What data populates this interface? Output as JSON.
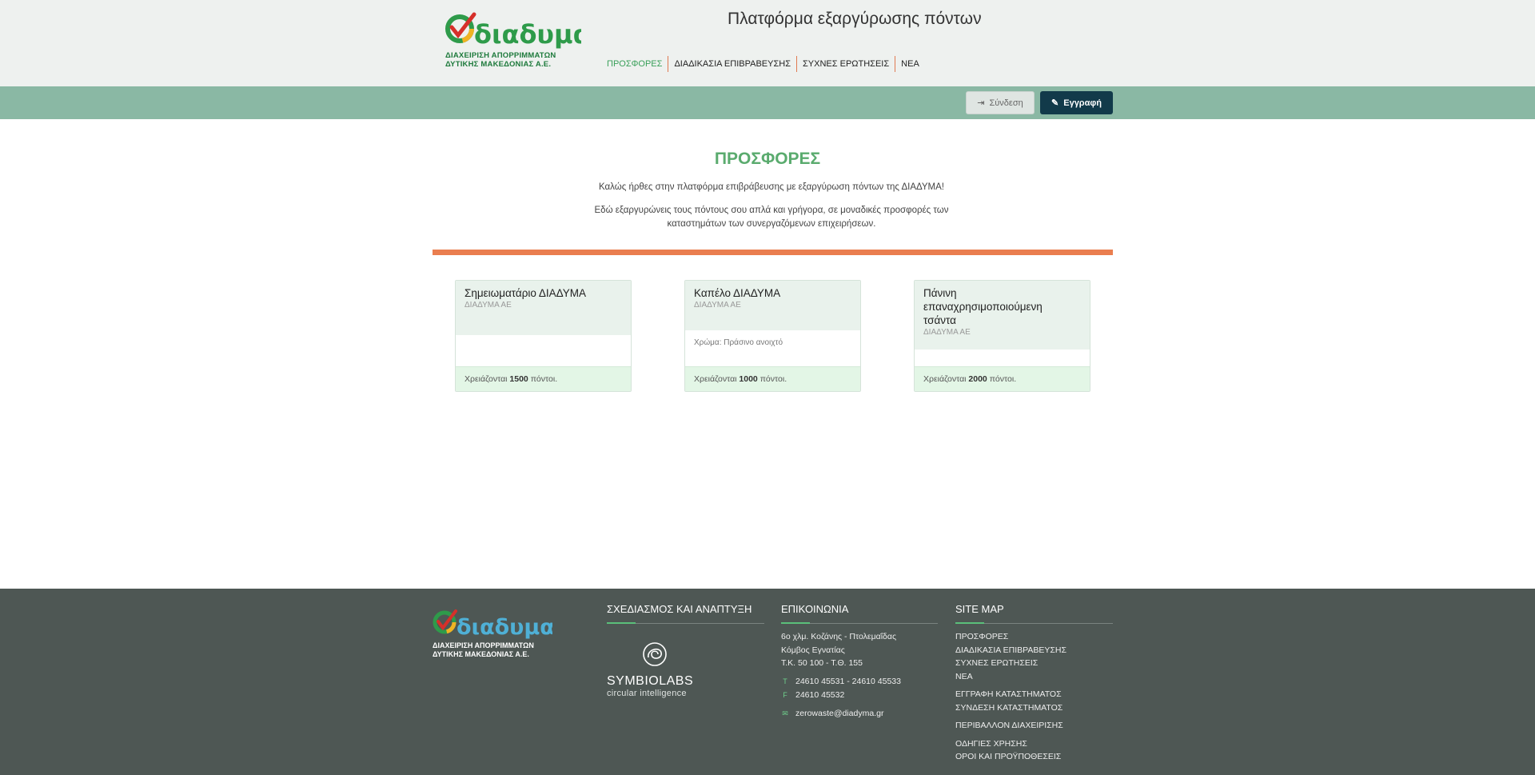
{
  "header": {
    "logo_text": "διαδυμα",
    "logo_subtitle": "ΔΙΑΧΕΙΡΙΣΗ ΑΠΟΡΡΙΜΜΑΤΩΝ\nΔΥΤΙΚΗΣ ΜΑΚΕΔΟΝΙΑΣ Α.Ε.",
    "site_title": "Πλατφόρμα εξαργύρωσης πόντων",
    "nav": [
      {
        "label": "ΠΡΟΣΦΟΡΕΣ",
        "active": true
      },
      {
        "label": "ΔΙΑΔΙΚΑΣΙΑ ΕΠΙΒΡΑΒΕΥΣΗΣ",
        "active": false
      },
      {
        "label": "ΣΥΧΝΕΣ ΕΡΩΤΗΣΕΙΣ",
        "active": false
      },
      {
        "label": "ΝΕΑ",
        "active": false
      }
    ]
  },
  "actions": {
    "login_label": "Σύνδεση",
    "register_label": "Εγγραφή"
  },
  "main": {
    "title": "ΠΡΟΣΦΟΡΕΣ",
    "intro_1": "Καλώς ήρθες στην πλατφόρμα επιβράβευσης με εξαργύρωση πόντων της ΔΙΑΔΥΜΑ!",
    "intro_2": "Εδώ εξαργυρώνεις τους πόντους σου απλά και γρήγορα, σε μοναδικές προσφορές των καταστημάτων των συνεργαζόμενων επιχειρήσεων."
  },
  "offers": [
    {
      "title": "Σημειωματάριο ΔΙΑΔΥΜΑ",
      "company": "ΔΙΑΔΥΜΑ ΑΕ",
      "detail": "",
      "points_prefix": "Χρειάζονται",
      "points": "1500",
      "points_suffix": "πόντοι."
    },
    {
      "title": "Καπέλο ΔΙΑΔΥΜΑ",
      "company": "ΔΙΑΔΥΜΑ ΑΕ",
      "detail": "Χρώμα: Πράσινο ανοιχτό",
      "points_prefix": "Χρειάζονται",
      "points": "1000",
      "points_suffix": "πόντοι."
    },
    {
      "title": "Πάνινη επαναχρησιμοποιούμενη τσάντα",
      "company": "ΔΙΑΔΥΜΑ ΑΕ",
      "detail": "",
      "points_prefix": "Χρειάζονται",
      "points": "2000",
      "points_suffix": "πόντοι."
    }
  ],
  "footer": {
    "logo_text": "διαδυμα",
    "logo_subtitle": "ΔΙΑΧΕΙΡΙΣΗ ΑΠΟΡΡΙΜΜΑΤΩΝ\nΔΥΤΙΚΗΣ ΜΑΚΕΔΟΝΙΑΣ Α.Ε.",
    "design_heading": "ΣΧΕΔΙΑΣΜΟΣ ΚΑΙ ΑΝΑΠΤΥΞΗ",
    "symbiolabs_name": "SYMBIOLABS",
    "symbiolabs_tagline": "circular intelligence",
    "contact_heading": "ΕΠΙΚΟΙΝΩΝΙΑ",
    "address_1": "6ο χλμ. Κοζάνης - Πτολεμαΐδας",
    "address_2": "Κόμβος Εγνατίας",
    "address_3": "Τ.Κ. 50 100 - Τ.Θ. 155",
    "phone": "24610 45531 - 24610 45533",
    "fax": "24610 45532",
    "email": "zerowaste@diadyma.gr",
    "sitemap_heading": "SITE MAP",
    "sitemap": {
      "group1": [
        "ΠΡΟΣΦΟΡΕΣ",
        "ΔΙΑΔΙΚΑΣΙΑ ΕΠΙΒΡΑΒΕΥΣΗΣ",
        "ΣΥΧΝΕΣ ΕΡΩΤΗΣΕΙΣ",
        "ΝΕΑ"
      ],
      "group2": [
        "ΕΓΓΡΑΦΗ ΚΑΤΑΣΤΗΜΑΤΟΣ",
        "ΣΥΝΔΕΣΗ ΚΑΤΑΣΤΗΜΑΤΟΣ"
      ],
      "group3": [
        "ΠΕΡΙΒΑΛΛΟΝ ΔΙΑΧΕΙΡΙΣΗΣ"
      ],
      "group4": [
        "ΟΔΗΓΙΕΣ ΧΡΗΣΗΣ",
        "ΟΡΟΙ ΚΑΙ ΠΡΟΫΠΟΘΕΣΕΙΣ"
      ]
    }
  },
  "colors": {
    "accent_green": "#5aab6e",
    "bar_green": "#8ab8a4",
    "divider_orange": "#ea7e4f",
    "register_navy": "#123a4a",
    "footer_bg": "#4e5754"
  }
}
